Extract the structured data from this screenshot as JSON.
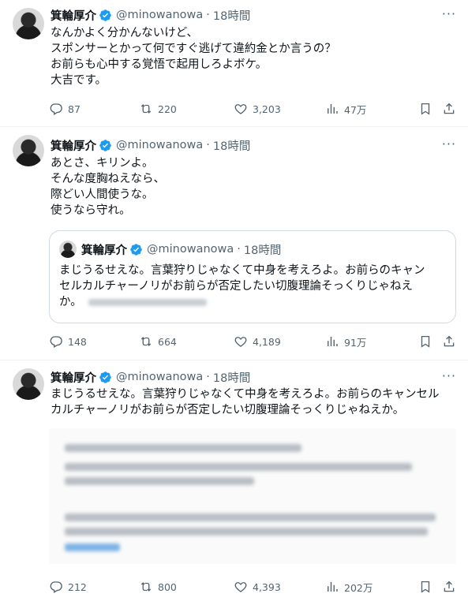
{
  "tweets": [
    {
      "name": "箕輪厚介",
      "handle": "@minowanowa",
      "dot": "·",
      "time": "18時間",
      "lines": [
        "なんかよく分かんないけど、",
        "スポンサーとかって何ですぐ逃げて違約金とか言うの？",
        "お前らも心中する覚悟で起用しろよボケ。",
        "大吉です。"
      ],
      "replies": "87",
      "retweets": "220",
      "likes": "3,203",
      "views": "47万"
    },
    {
      "name": "箕輪厚介",
      "handle": "@minowanowa",
      "dot": "·",
      "time": "18時間",
      "lines": [
        "あとさ、キリンよ。",
        "そんな度胸ねえなら、",
        "際どい人間使うな。",
        "使うなら守れ。"
      ],
      "quote": {
        "name": "箕輪厚介",
        "handle": "@minowanowa",
        "dot": "·",
        "time": "18時間",
        "lines": [
          "まじうるせえな。言葉狩りじゃなくて中身を考えろよ。お前らのキャン",
          "セルカルチャーノリがお前らが否定したい切腹理論そっくりじゃねえ",
          "か。"
        ]
      },
      "replies": "148",
      "retweets": "664",
      "likes": "4,189",
      "views": "91万"
    },
    {
      "name": "箕輪厚介",
      "handle": "@minowanowa",
      "dot": "·",
      "time": "18時間",
      "lines": [
        "まじうるせえな。言葉狩りじゃなくて中身を考えろよ。お前らのキャンセル",
        "カルチャーノリがお前らが否定したい切腹理論そっくりじゃねえか。"
      ],
      "replies": "212",
      "retweets": "800",
      "likes": "4,393",
      "views": "202万"
    }
  ],
  "colors": {
    "verified": "#1d9bf0",
    "muted": "#536471",
    "text": "#0f1419",
    "border": "#cfd9de"
  },
  "icons": [
    "reply-icon",
    "retweet-icon",
    "like-icon",
    "views-icon",
    "bookmark-icon",
    "share-icon",
    "verified-badge-icon",
    "more-icon"
  ]
}
